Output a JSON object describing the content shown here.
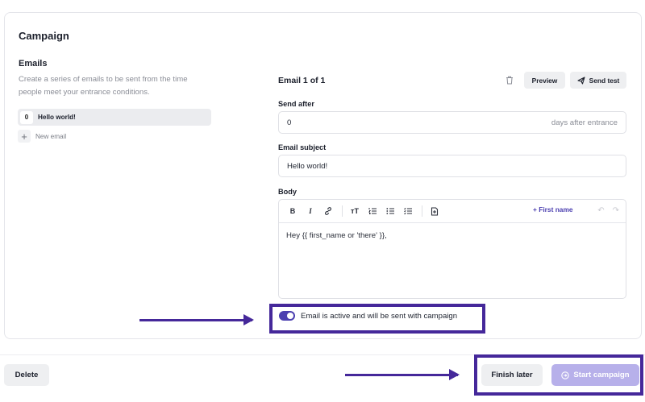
{
  "card": {
    "title": "Campaign"
  },
  "left": {
    "title": "Emails",
    "description": "Create a series of emails to be sent from the time people meet your entrance conditions.",
    "emails": [
      {
        "number": "0",
        "name": "Hello world!"
      }
    ],
    "new_email_label": "New email"
  },
  "editor": {
    "header": "Email 1 of 1",
    "preview_label": "Preview",
    "send_test_label": "Send test",
    "send_after": {
      "label": "Send after",
      "value": "0",
      "suffix": "days after entrance"
    },
    "subject": {
      "label": "Email subject",
      "value": "Hello world!"
    },
    "body": {
      "label": "Body",
      "toolbar": {
        "bold": "B",
        "italic": "I",
        "text_size": "тT",
        "first_name_label": "+ First name"
      },
      "content": "Hey {{ first_name or 'there' }},"
    },
    "active_toggle": {
      "on": true,
      "label": "Email is active and will be sent with campaign"
    }
  },
  "footer": {
    "delete_label": "Delete",
    "finish_later_label": "Finish later",
    "start_campaign_label": "Start campaign"
  },
  "colors": {
    "accent": "#4b3fb0",
    "annotation": "#45289a",
    "start_disabled": "#b7b0ea"
  },
  "icons": [
    "trash-icon",
    "send-icon",
    "plus-icon",
    "link-icon",
    "ordered-list-icon",
    "bullet-list-icon",
    "insert-icon",
    "undo-icon",
    "redo-icon",
    "start-icon"
  ]
}
